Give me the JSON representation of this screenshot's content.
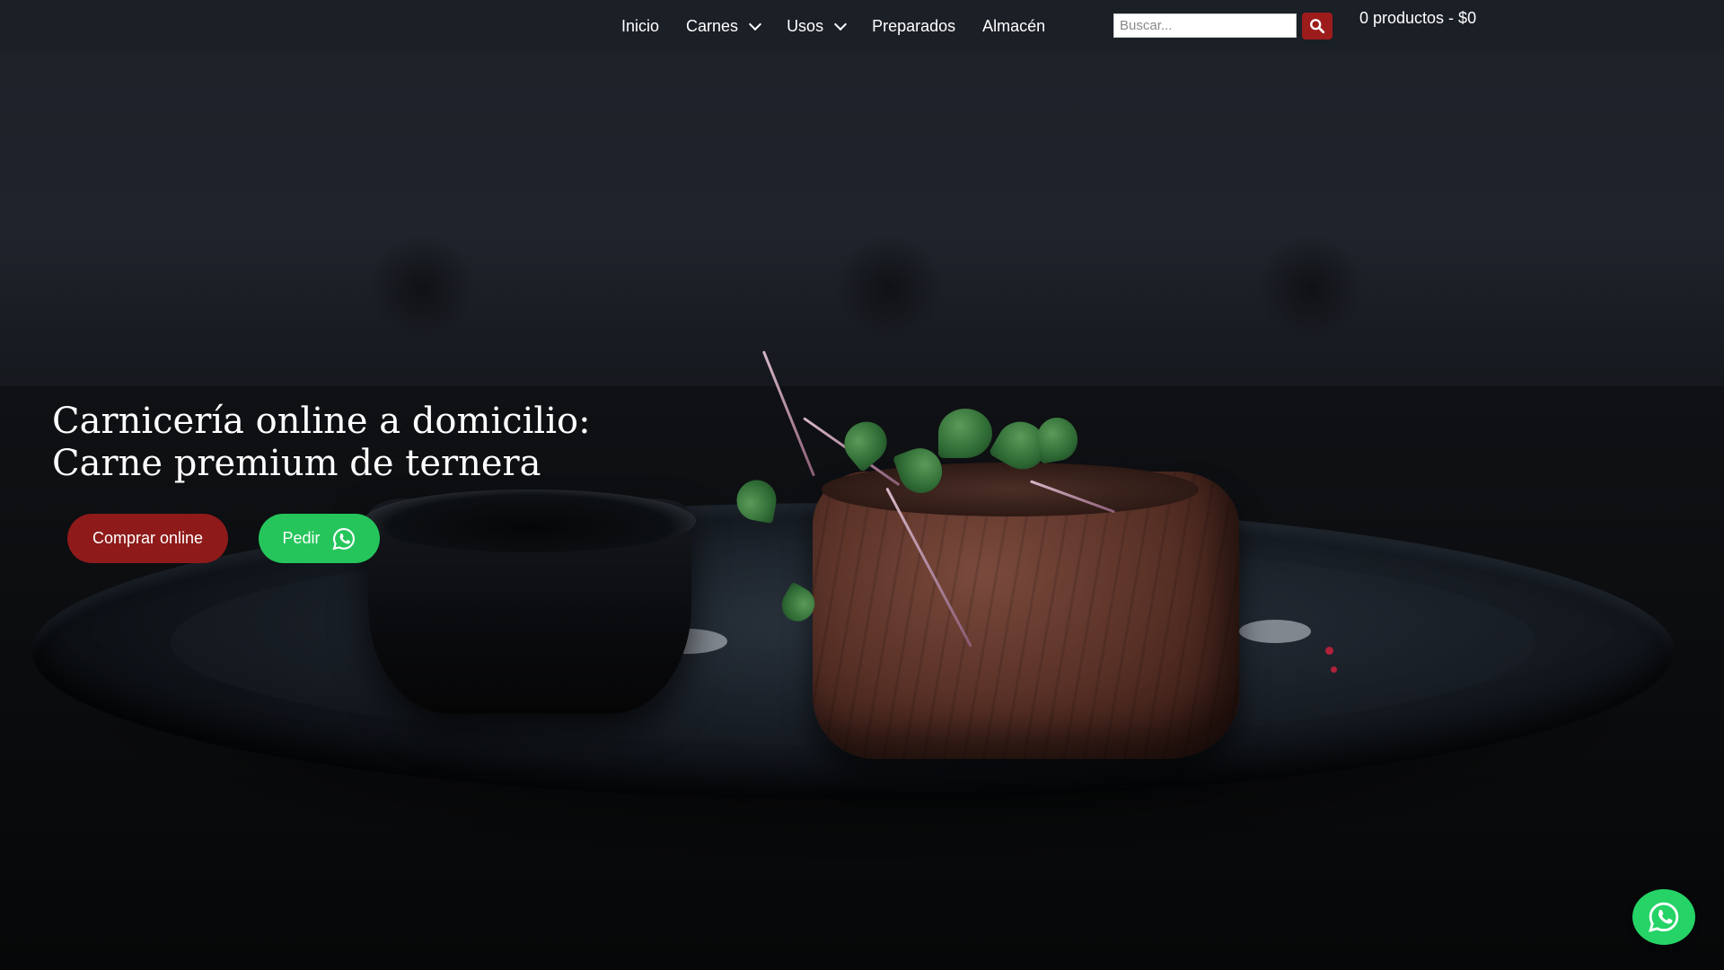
{
  "nav": {
    "items": [
      {
        "label": "Inicio",
        "dropdown": false
      },
      {
        "label": "Carnes",
        "dropdown": true
      },
      {
        "label": "Usos",
        "dropdown": true
      },
      {
        "label": "Preparados",
        "dropdown": false
      },
      {
        "label": "Almacén",
        "dropdown": false
      }
    ]
  },
  "search": {
    "placeholder": "Buscar...",
    "value": "",
    "button_icon": "search-icon"
  },
  "cart": {
    "label": "0 productos - $0"
  },
  "hero": {
    "title_line1": "Carnicería online a domicilio:",
    "title_line2": "Carne premium de ternera",
    "primary_button": "Comprar online",
    "whatsapp_button": "Pedir",
    "whatsapp_icon": "whatsapp-icon"
  },
  "floating": {
    "icon": "whatsapp-icon"
  },
  "colors": {
    "header_bg": "#1b1f26",
    "brand_red": "#8e1a1a",
    "whatsapp_green": "#25c55b",
    "text": "#ffffff"
  }
}
